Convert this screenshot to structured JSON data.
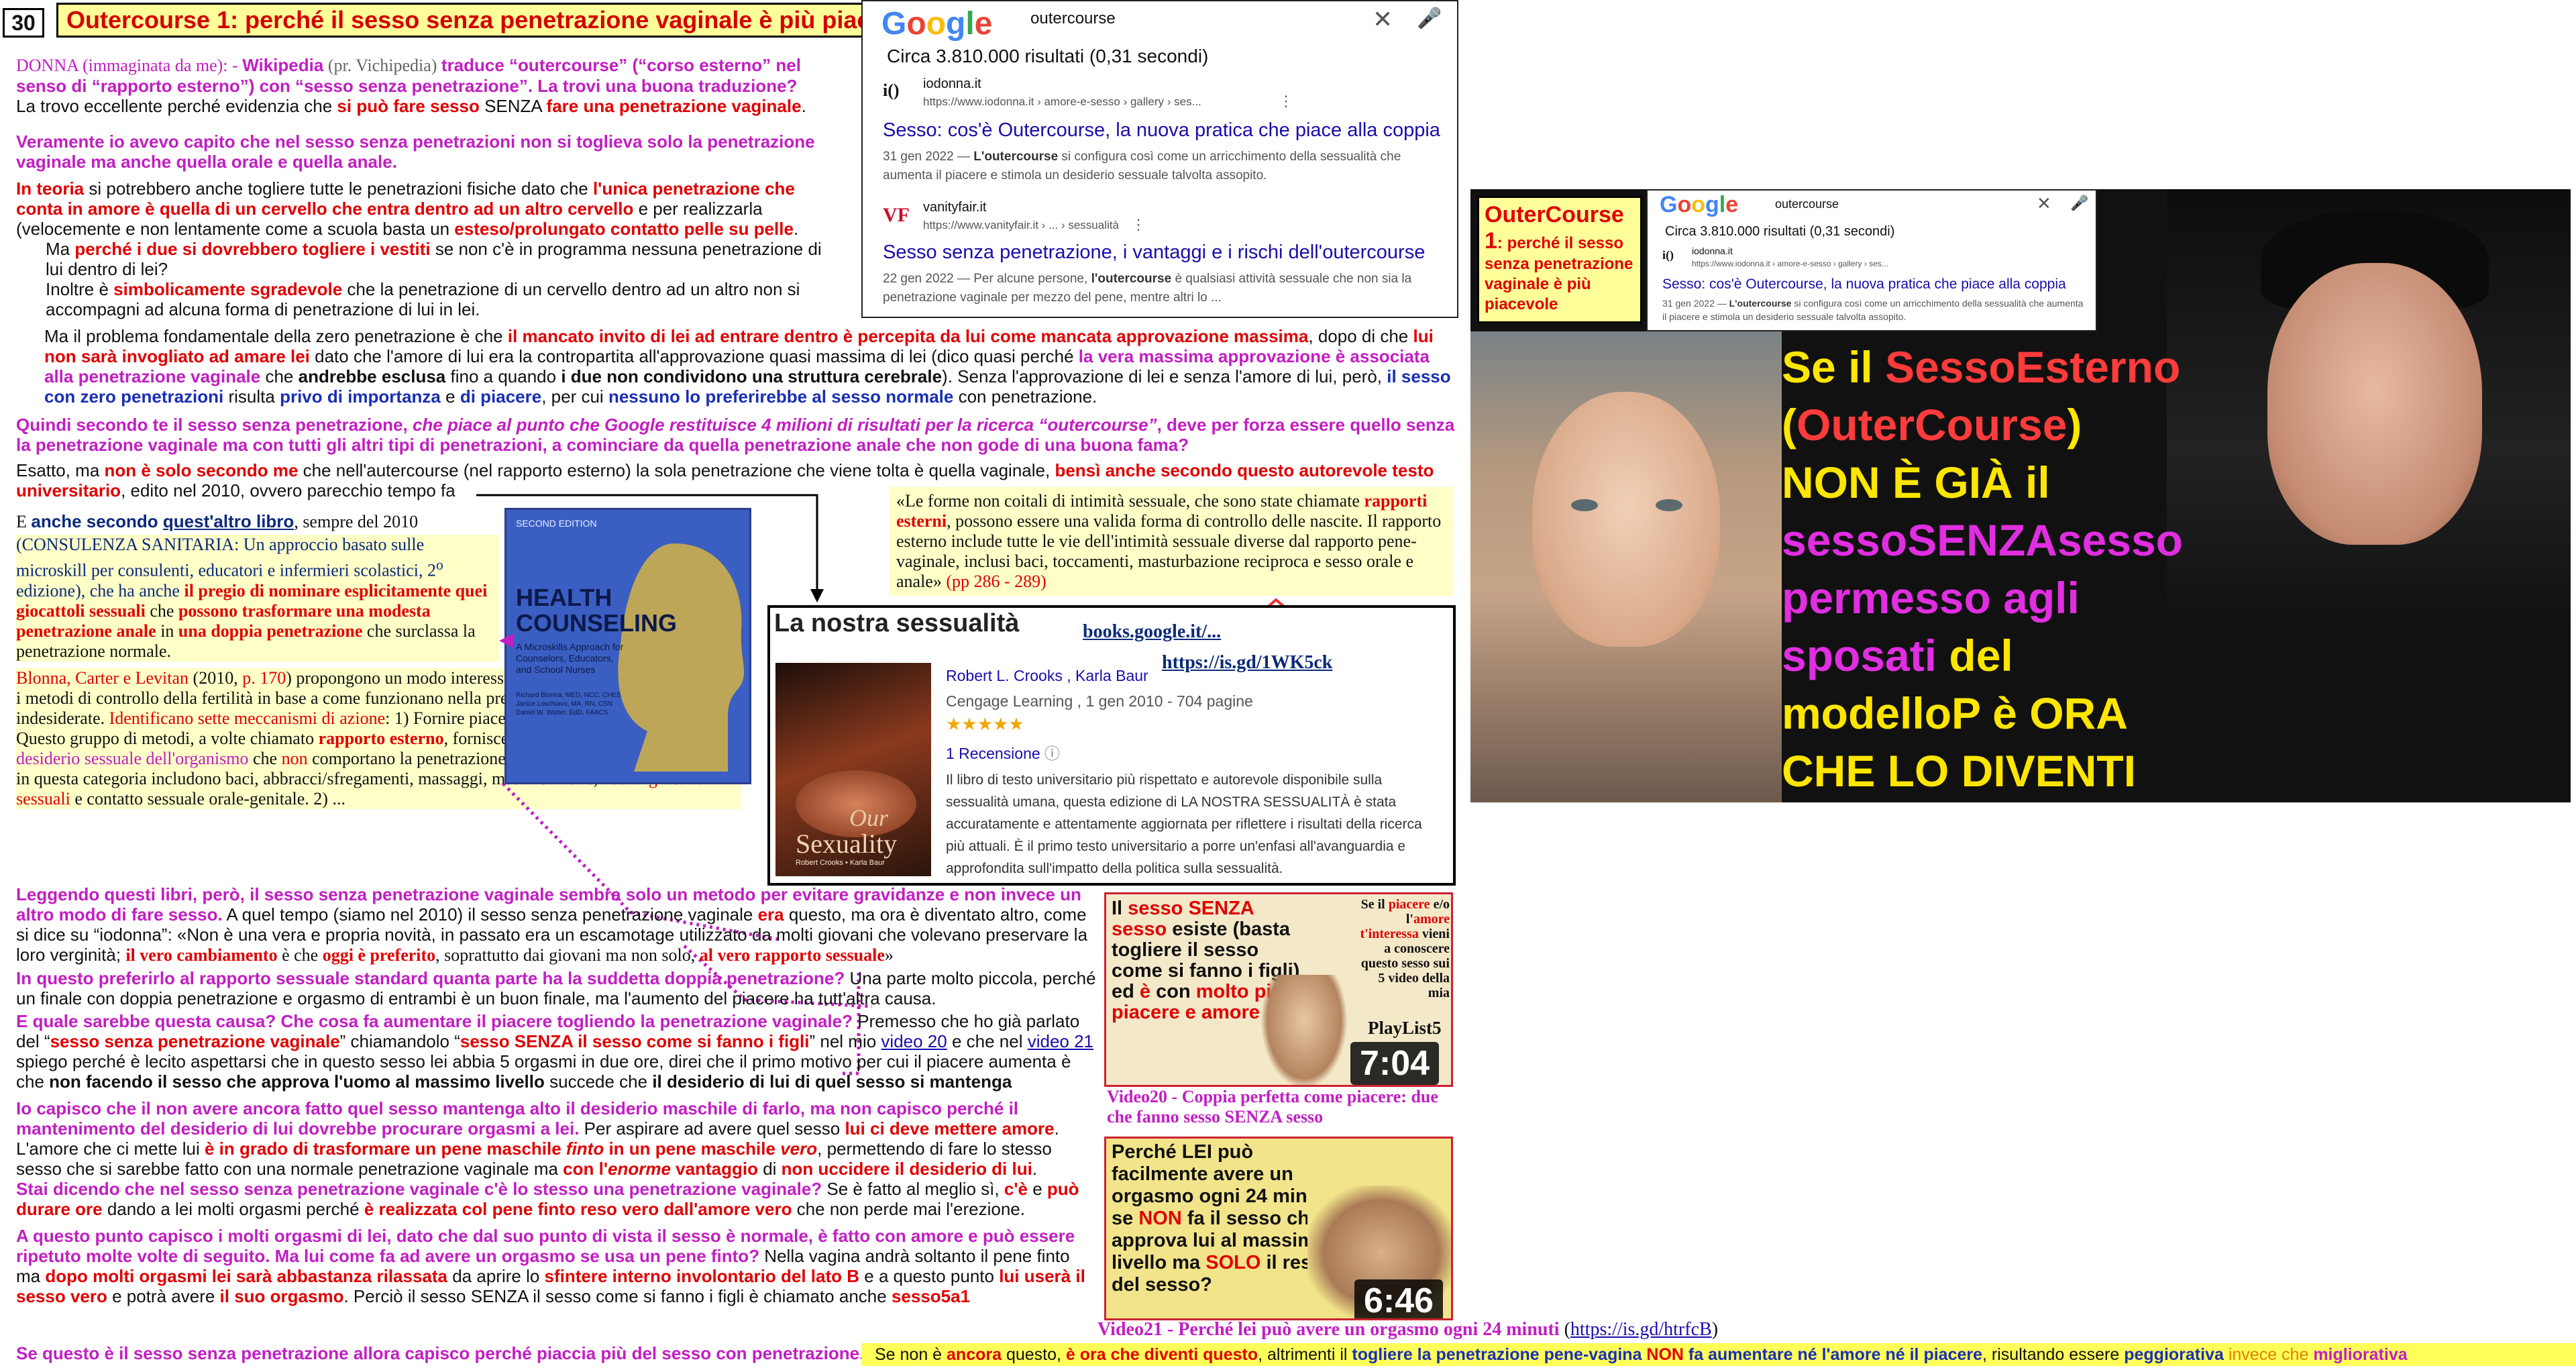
{
  "header": {
    "slide_number": "30",
    "title": "Outercourse 1: perché il sesso senza penetrazione vaginale è più piacevole"
  },
  "google_top": {
    "query": "outercourse",
    "results_count": "Circa 3.810.000 risultati (0,31 secondi)",
    "result1": {
      "site": "iodonna.it",
      "url": "https://www.iodonna.it › amore-e-sesso › gallery › ses...",
      "title": "Sesso: cos'è Outercourse, la nuova pratica che piace alla coppia",
      "date": "31 gen 2022 — ",
      "snippet_bold": "L'outercourse",
      "snippet": " si configura così come un arricchimento della sessualità che aumenta il piacere e stimola un desiderio sessuale talvolta assopito."
    },
    "result2": {
      "site": "vanityfair.it",
      "url": "https://www.vanityfair.it › ... › sessualità",
      "title": "Sesso senza penetrazione, i vantaggi e i rischi dell'outercourse",
      "date": "22 gen 2022 — Per alcune persone, ",
      "snippet_bold": "l'outercourse",
      "snippet": " è qualsiasi attività sessuale che non sia la penetrazione vaginale per mezzo del pene, mentre altri lo ..."
    }
  },
  "left_text": {
    "p1": {
      "a": "DONNA (immaginata da me): - ",
      "b": "Wikipedia",
      "c": " (pr. Vichipedia) ",
      "d": "traduce “outercourse” (“corso esterno” nel senso di “rapporto esterno”) con “sesso senza penetrazione”. La trovi una buona traduzione?"
    },
    "p2": {
      "a": "La trovo eccellente perché evidenzia che ",
      "b": "si può fare sesso",
      "c": " SENZA ",
      "d": "fare una penetrazione vaginale",
      "e": "."
    },
    "p3": "Veramente io avevo capito che nel sesso senza penetrazioni non si toglieva solo la penetrazione vaginale ma anche quella orale e quella anale.",
    "p4": {
      "a": "In teoria",
      "b": " si potrebbero anche togliere tutte le penetrazioni fisiche dato che ",
      "c": "l'unica penetrazione che conta in amore è quella di un cervello che entra dentro ad un altro cervello",
      "d": " e per realizzarla (velocemente e non lentamente come a scuola basta un ",
      "e": "esteso/prolungato contatto pelle su pelle",
      "f": "."
    },
    "p5": {
      "a": "Ma ",
      "b": "perché i due si dovrebbero togliere i vestiti",
      "c": " se non c'è in programma nessuna penetrazione di lui dentro di lei?"
    },
    "p6": {
      "a": "Inoltre è ",
      "b": "simbolicamente sgradevole",
      "c": " che la penetrazione di un cervello dentro ad un altro non si accompagni ad alcuna forma di penetrazione di lui in lei."
    },
    "p7": {
      "a": "Ma il problema fondamentale della zero penetrazione è che ",
      "b": "il mancato invito di lei ad entrare dentro è percepita da lui come mancata approvazione massima",
      "c": ", dopo di che ",
      "d": "lui non sarà invogliato ad amare lei",
      "e": " dato che l'amore di lui era la contropartita all'approvazione quasi massima di lei (dico quasi perché ",
      "f": "la vera massima approvazione è associata alla penetrazione vaginale",
      "g": " che ",
      "h": "andrebbe esclusa",
      "i": " fino a quando ",
      "j": "i due non condividono una struttura cerebrale",
      "k": "). Senza l'approvazione di lei e senza l'amore di lui, però, ",
      "l": "il sesso con zero penetrazioni",
      "m": " risulta ",
      "n": "privo di importanza",
      "o": " e ",
      "p": "di piacere",
      "q": ", per cui ",
      "r": "nessuno lo preferirebbe al sesso normale",
      "s": " con penetrazione."
    },
    "p8": {
      "a": "Quindi secondo te il sesso senza penetrazione, ",
      "b": "che piace al punto che Google restituisce 4 milioni di risultati per la ricerca “outercourse”",
      "c": ", deve per forza essere quello senza la penetrazione vaginale ma con tutti gli altri tipi di penetrazioni, a cominciare da quella penetrazione anale che non gode di una buona fama?"
    },
    "p9": {
      "a": "Esatto, ma ",
      "b": "non è solo secondo me",
      "c": " che nell'autercourse (nel rapporto esterno) la sola penetrazione che viene tolta è quella vaginale, ",
      "d": "bensì anche secondo questo autorevole testo universitario",
      "e": ", edito nel 2010, ovvero parecchio tempo fa"
    }
  },
  "quote_box": {
    "a": "«Le forme non coitali di intimità sessuale, che sono state chiamate ",
    "b": "rapporti esterni",
    "c": ", possono essere una valida forma di controllo delle nascite. Il rapporto esterno include tutte le vie dell'intimità sessuale diverse dal rapporto pene-vaginale, inclusi baci, toccamenti, masturbazione reciproca e sesso orale e anale» ",
    "d": "(pp 286 - 289)"
  },
  "book": {
    "title": "La nostra sessualità",
    "link1": "books.google.it/...",
    "link2": "https://is.gd/1WK5ck",
    "authors": "Robert L. Crooks , Karla Baur",
    "publisher": "Cengage Learning , 1 gen 2010 - 704 pagine",
    "stars": "★★★★★",
    "reviews": "1 Recensione",
    "description": "Il libro di testo universitario più rispettato e autorevole disponibile sulla sessualità umana, questa edizione di LA NOSTRA SESSUALITÀ è stata accuratamente e attentamente aggiornata per riflettere i risultati della ricerca più attuali. È il primo testo universitario a porre un'enfasi all'avanguardia e approfondita sull'impatto della politica sulla sessualità.",
    "cover_word1": "Our",
    "cover_word2": "Sexuality",
    "cover_authors": "Robert Crooks • Karla Baur"
  },
  "health_book": {
    "title": "HEALTH COUNSELING",
    "subtitle": "A Microskills Approach for Counselors, Educators, and School Nurses",
    "authors": "Richard Blonna, MED, NCC, CHES\nJanice Loschiavo, MA, RN, CSN\nDaniel W. Watter, EdD, FAACS",
    "edition": "SECOND EDITION"
  },
  "health_text": {
    "a": "E ",
    "b": "anche secondo ",
    "c": "quest'altro libro",
    "d": ", sempre del 2010",
    "e": "(CONSULENZA SANITARIA: Un approccio basato sulle microskill per consulenti, educatori e infermieri scolastici, 2",
    "e_sup": "o",
    "f": " edizione), che ha anche ",
    "g": "il pregio di nominare esplicitamente quei giocattoli sessuali",
    "h": " che ",
    "i": "possono trasformare una modesta penetrazione anale",
    "j": " in ",
    "k": "una doppia penetrazione",
    "l": " che surclassa la penetrazione normale.",
    "m": "Blonna, Carter e Levitan",
    "n": " (2010, ",
    "o": "p. 170",
    "p": ") propongono un modo interessante ma semplice per raggruppare i metodi di controllo della fertilità in base a come funzionano nella prevenzione di gravidanze indesiderate. ",
    "q": "Identificano sette meccanismi di azione",
    "r": ":  1) Fornire piacere sessuale non penetrativo. Questo gruppo di metodi, a volte chiamato ",
    "s": "rapporto esterno",
    "t": ", fornisce opzioni ",
    "u": "per la soddisfazione del desiderio sessuale",
    "v": " dell'organismo",
    "w": " che ",
    "x": "non",
    "y": " comportano la penetrazione del pene nella vagina. I metodi in questa categoria includono baci, abbracci/sfregamenti, massaggi, masturbazione, ",
    "z": "uso di giocattoli sessuali",
    "zz": " e contatto sessuale orale-genitale. 2) ..."
  },
  "bottom_text": {
    "q1": {
      "a": "Leggendo questi libri, però, il sesso senza penetrazione vaginale sembra solo un metodo per evitare gravidanze e non invece un altro modo di fare sesso.",
      "b": "   A quel tempo (siamo nel 2010) il sesso senza penetrazione vaginale ",
      "c": "era",
      "d": " questo, ma ora è diventato altro, come si dice su “iodonna”: «Non è una vera e propria novità, in passato era un escamotage utilizzato da molti giovani che volevano preservare la loro verginità; ",
      "e": "il vero cambiamento",
      "f": " è che ",
      "g": "oggi è preferito",
      "h": ", soprattutto dai giovani ma non solo, ",
      "i": "al vero rapporto sessuale",
      "j": "»"
    },
    "q2": {
      "a": "In questo preferirlo al rapporto sessuale standard quanta parte ha la suddetta doppia penetrazione?",
      "b": "  Una parte molto piccola, perché un finale con doppia penetrazione e orgasmo di entrambi è un buon finale, ma l'aumento del piacere ha tutt'altra causa."
    },
    "q3": {
      "a": "E quale sarebbe questa causa? Che cosa fa aumentare il piacere togliendo la penetrazione vaginale?",
      "b": " Premesso che ho già parlato del “",
      "c": "sesso senza penetrazione vaginale",
      "d": "” chiamandolo “",
      "e": "sesso SENZA il sesso come si fanno i figli",
      "f": "” nel mio ",
      "g": "video 20",
      "h": " e che nel ",
      "i": "video 21",
      "j": " spiego perché è lecito aspettarsi che in questo sesso lei abbia 5 orgasmi in due ore, direi che il primo motivo per cui il piacere aumenta è che ",
      "k": "non facendo il sesso che approva l'uomo al massimo livello",
      "l": " succede che ",
      "m": "il desiderio di lui di quel sesso si mantenga"
    },
    "q4": {
      "a": "Io capisco che il non avere ancora fatto quel sesso mantenga alto il desiderio maschile di farlo, ma non capisco perché il mantenimento del desiderio di lui dovrebbe procurare orgasmi a lei.",
      "b": "  Per aspirare ad avere quel sesso ",
      "c": "lui ci deve mettere amore",
      "d": ". L'amore che ci mette lui ",
      "e": "è in grado di trasformare un pene maschile ",
      "f": "finto",
      "g": " in un pene maschile ",
      "h": "vero",
      "i": ", permettendo di fare lo stesso sesso che si sarebbe fatto con una normale penetrazione vaginale ma ",
      "j": "con l'",
      "k": "enorme",
      "l": " vantaggio",
      "m": " di ",
      "n": "non uccidere il desiderio di lui",
      "o": "."
    },
    "q5": {
      "a": "Stai dicendo che nel sesso senza penetrazione vaginale c'è lo stesso una penetrazione vaginale?",
      "b": "  Se è fatto al meglio sì, ",
      "c": "c'è",
      "d": " e ",
      "e": "può durare ore",
      "f": " dando a lei molti orgasmi perché ",
      "g": "è realizzata col pene finto reso vero dall'amore vero",
      "h": " che non perde mai l'erezione."
    },
    "q6": {
      "a": "A questo punto capisco i molti orgasmi di lei, dato che dal suo punto di vista il sesso è normale, è fatto con amore e può essere ripetuto molte volte di seguito. Ma lui come fa ad avere un orgasmo se usa un pene finto?",
      "b": " Nella vagina andrà soltanto il pene finto ma ",
      "c": "dopo molti orgasmi lei sarà abbastanza rilassata",
      "d": " da aprire lo ",
      "e": "sfintere interno involontario del lato B",
      "f": " e a questo punto ",
      "g": "lui userà il sesso vero",
      "h": " e potrà avere ",
      "i": "il suo orgasmo",
      "j": ". Perciò il sesso SENZA il sesso come si fanno i figli è chiamato anche ",
      "k": "sesso5a1"
    },
    "q7": "Se questo è il sesso senza penetrazione allora capisco perché piaccia più del sesso con penetrazione."
  },
  "bottom_strip": {
    "a": "Se non è ",
    "b": "ancora",
    "c": " questo, ",
    "d": "è ora che diventi questo",
    "e": ", altrimenti il ",
    "f": "togliere la penetrazione pene-vagina",
    "g": " NON",
    "h": " fa aumentare né l'amore né il piacere",
    "i": ", risultando essere ",
    "j": "peggiorativa",
    "k": " invece che ",
    "l": "migliorativa"
  },
  "video20": {
    "text_a": "Il ",
    "text_b": "sesso SENZA sesso",
    "text_c": " esiste (basta togliere il sesso come si fanno i figli) ed ",
    "text_d": "è",
    "text_e": " con ",
    "text_f": "molto più piacere e amore",
    "side_a": "Se il ",
    "side_b": "piacere",
    "side_c": " e/o l'",
    "side_d": "amore",
    "side_e": " t'interessa",
    "side_f": " vieni a conoscere questo sesso sui 5 video della mia",
    "playlist": "PlayList5",
    "duration": "7:04",
    "caption": "Video20 - Coppia perfetta come piacere: due che fanno sesso SENZA sesso"
  },
  "video21": {
    "text_a": "Perché LEI può facilmente avere un orgasmo ogni 24 minuti se ",
    "text_b": "NON",
    "text_c": " fa il sesso che approva lui al massimo livello ma ",
    "text_d": "SOLO",
    "text_e": " il resto del sesso?",
    "duration": "6:46",
    "caption_a": "Video21 - Perché lei può avere un orgasmo ogni 24 minuti",
    "caption_b": " (",
    "caption_link": "https://is.gd/htrfcB",
    "caption_c": ")"
  },
  "slide": {
    "title_a": "OuterCourse 1",
    "title_b": ": perché il sesso senza penetrazione vaginale è più piacevole",
    "big_a": "Se il ",
    "big_b": "SessoEsterno",
    "big_c": "(",
    "big_d": "OuterCourse",
    "big_e": ")",
    "big_f": "NON È GIÀ il",
    "big_g": "sessoSENZAsesso",
    "big_h": "permesso agli",
    "big_i": "sposati",
    "big_j": " del",
    "big_k": "modelloP è ORA",
    "big_l": "CHE LO DIVENTI"
  },
  "colors": {
    "magenta": "#c21ec2",
    "red": "#e00000",
    "blue": "#1a2fb4",
    "yellow_bg": "#ffffc8",
    "title_bg": "#ffff9a"
  }
}
